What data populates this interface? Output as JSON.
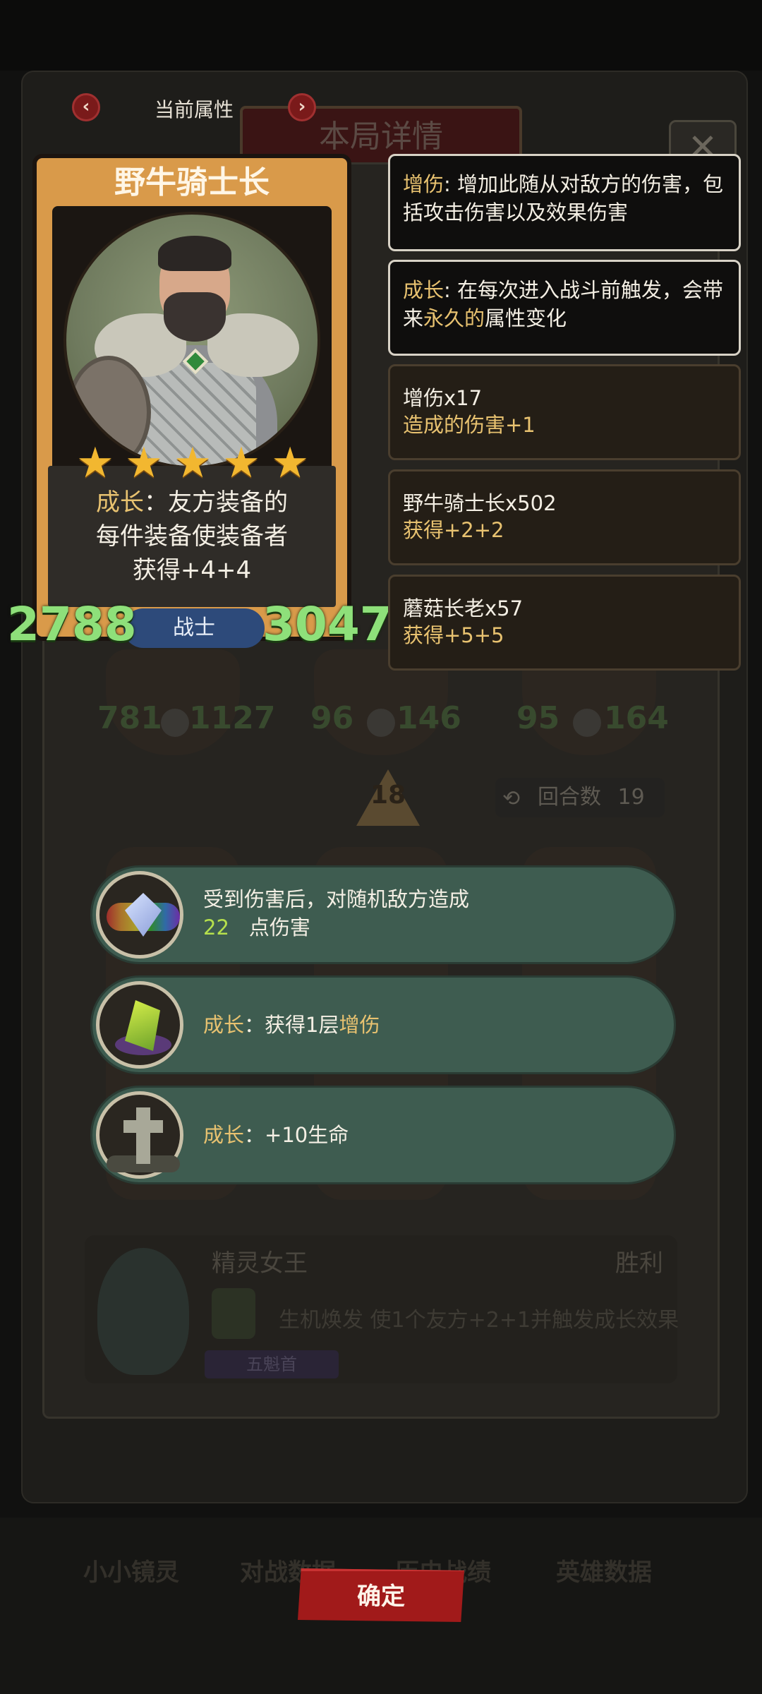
{
  "background": {
    "panel_title": "本局详情",
    "close_glyph": "✕",
    "board": {
      "row1": [
        {
          "atk": "781",
          "hp": "1127"
        },
        {
          "atk": "96",
          "hp": "146"
        },
        {
          "atk": "95",
          "hp": "164"
        }
      ],
      "turn_arrow_number": "18",
      "round_label": "回合数",
      "round_value": "19"
    },
    "log": {
      "hero_name": "精灵女王",
      "result": "胜利",
      "desc": "生机焕发 使1个友方+2+1并触发成长效果",
      "badge": "五魁首"
    },
    "bottom_nav": [
      "小小镜灵",
      "对战数据",
      "历史战绩",
      "英雄数据"
    ]
  },
  "header": {
    "title": "当前属性",
    "prev_glyph": "‹",
    "next_glyph": "›"
  },
  "card": {
    "name": "野牛骑士长",
    "stars": 5,
    "star_glyph": "★",
    "desc_keyword": "成长",
    "desc_rest_1": "：友方装备的",
    "desc_line2": "每件装备使装备者",
    "desc_line3": "获得+4+4",
    "class": "战士",
    "atk": "2788",
    "hp": "3047"
  },
  "tooltips": [
    {
      "keyword": "增伤",
      "text": ": 增加此随从对敌方的伤害，包括攻击伤害以及效果伤害"
    },
    {
      "keyword": "成长",
      "text_a": ": 在每次进入战斗前触发，会带来",
      "highlight": "永久的",
      "text_b": "属性变化"
    }
  ],
  "sources": [
    {
      "name": "增伤x17",
      "effect": "造成的伤害+1"
    },
    {
      "name": "野牛骑士长x502",
      "effect": "获得+2+2"
    },
    {
      "name": "蘑菇长老x57",
      "effect": "获得+5+5"
    }
  ],
  "effects": [
    {
      "line1": "受到伤害后，对随机敌方造成",
      "value": "22",
      "line2": "点伤害",
      "icon": "rainbow-crystal-icon"
    },
    {
      "keyword": "成长",
      "text": "：获得1层",
      "highlight": "增伤",
      "icon": "green-crystal-icon"
    },
    {
      "keyword": "成长",
      "text": "：+10生命",
      "icon": "tombstone-cross-icon"
    }
  ],
  "confirm_label": "确定",
  "colors": {
    "gold_text": "#e8c270",
    "stat_green": "#8ee07a",
    "pill_green": "#3e5c50",
    "confirm_red": "#a11a1a",
    "card_orange": "#d99a4a",
    "class_blue": "#2d4a7a"
  }
}
